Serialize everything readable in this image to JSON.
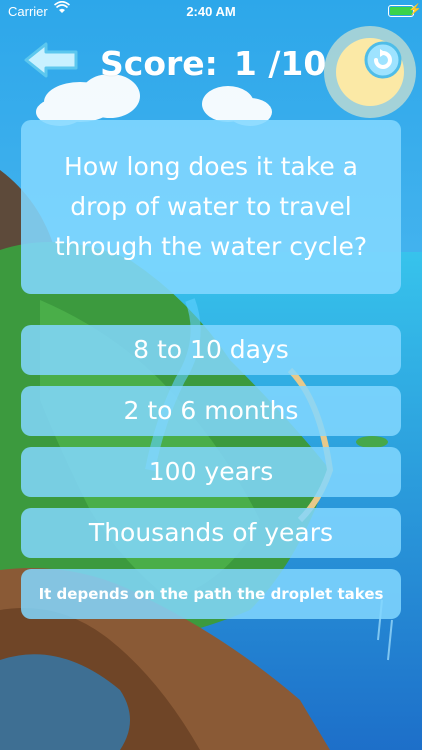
{
  "status_bar": {
    "carrier": "Carrier",
    "time": "2:40 AM",
    "wifi_icon": "wifi-icon",
    "battery_icon": "battery-icon"
  },
  "header": {
    "back_icon": "back-arrow-icon",
    "score_label": "Score:",
    "score_current": "1",
    "score_total": "/10",
    "refresh_icon": "refresh-icon"
  },
  "question": {
    "lines": [
      "How long does it take a",
      "drop of water to travel",
      "through the water cycle?"
    ]
  },
  "answers": [
    "8 to 10 days",
    "2 to 6 months",
    "100 years",
    "Thousands of years",
    "It depends on the path the droplet takes"
  ],
  "colors": {
    "sky": "#4fb8f0",
    "panel": "#82d7ff",
    "text": "#ffffff"
  }
}
